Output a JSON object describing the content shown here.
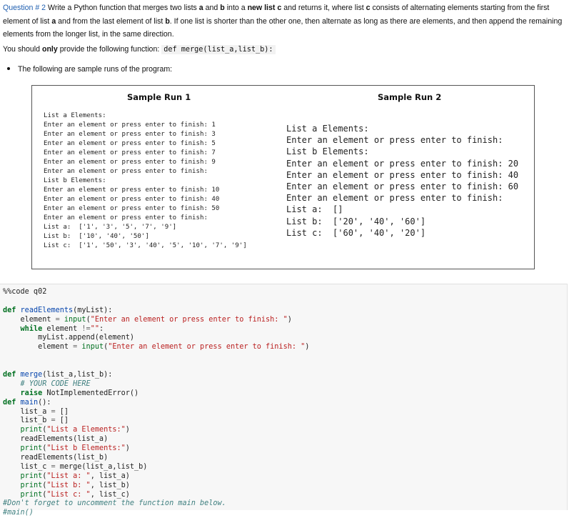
{
  "question": {
    "label": "Question # 2",
    "text_1": " Write a Python function that merges two lists ",
    "a": "a",
    "text_2": " and ",
    "b": "b",
    "text_3": " into a ",
    "new_list": "new list",
    "c": "c",
    "text_4": " and returns it, where list ",
    "c2": "c",
    "text_5": " consists of alternating elements starting from the first element of list ",
    "a2": "a",
    "text_6": " and from the last element of list ",
    "b2": "b",
    "text_7": ". If one list is shorter than the other one, then alternate as long as there are elements, and then append the remaining elements from the longer list, in the same direction."
  },
  "instruction": {
    "prefix": "You should ",
    "only": "only",
    "suffix": " provide the following function: ",
    "signature": "def merge(list_a,list_b):"
  },
  "bullet": "The following are sample runs of the program:",
  "sample_runs": {
    "run1": {
      "title": "Sample Run 1",
      "lines": [
        "List a Elements:",
        "Enter an element or press enter to finish: 1",
        "Enter an element or press enter to finish: 3",
        "Enter an element or press enter to finish: 5",
        "Enter an element or press enter to finish: 7",
        "Enter an element or press enter to finish: 9",
        "Enter an element or press enter to finish:",
        "List b Elements:",
        "Enter an element or press enter to finish: 10",
        "Enter an element or press enter to finish: 40",
        "Enter an element or press enter to finish: 50",
        "Enter an element or press enter to finish:",
        "List a:  ['1', '3', '5', '7', '9']",
        "List b:  ['10', '40', '50']",
        "List c:  ['1', '50', '3', '40', '5', '10', '7', '9']"
      ]
    },
    "run2": {
      "title": "Sample Run 2",
      "lines": [
        "List a Elements:",
        "Enter an element or press enter to finish:",
        "List b Elements:",
        "Enter an element or press enter to finish: 20",
        "Enter an element or press enter to finish: 40",
        "Enter an element or press enter to finish: 60",
        "Enter an element or press enter to finish:",
        "List a:  []",
        "List b:  ['20', '40', '60']",
        "List c:  ['60', '40', '20']"
      ]
    }
  },
  "code": {
    "magic": "%%code q02",
    "l_def1": "def",
    "l_readElements": "readElements",
    "l_readElements_args": "(myList):",
    "l_elem_assign": "    element ",
    "l_eq": "=",
    "l_input": "input",
    "l_prompt": "\"Enter an element or press enter to finish: \"",
    "l_paren_open": "(",
    "l_paren_close": ")",
    "l_while": "while",
    "l_while_rest": " element ",
    "l_neq": "!=",
    "l_empty": "\"\"",
    "l_colon": ":",
    "l_append": "        myList.append(element)",
    "l_elem_assign2": "        element ",
    "l_def2": "def",
    "l_merge": "merge",
    "l_merge_args": "(list_a,list_b):",
    "l_todo": "# YOUR CODE HERE",
    "l_raise": "raise",
    "l_notimpl": " NotImplementedError",
    "l_parens": "()",
    "l_def3": "def",
    "l_main": "main",
    "l_main_args": "():",
    "l_list_a": "    list_a ",
    "l_list_b": "    list_b ",
    "l_brackets": " []",
    "l_print": "print",
    "s_list_a_el": "\"List a Elements:\"",
    "s_list_b_el": "\"List b Elements:\"",
    "l_read_a": "    readElements(list_a)",
    "l_read_b": "    readElements(list_b)",
    "l_list_c": "    list_c ",
    "l_merge_call": " merge(list_a,list_b)",
    "s_list_a": "\"List a: \"",
    "s_list_b": "\"List b: \"",
    "s_list_c": "\"List c: \"",
    "a_list_a": ", list_a)",
    "a_list_b": ", list_b)",
    "a_list_c": ", list_c)",
    "comment_dont": "#Don't forget to uncomment the function main below.",
    "comment_main": "#main()"
  }
}
